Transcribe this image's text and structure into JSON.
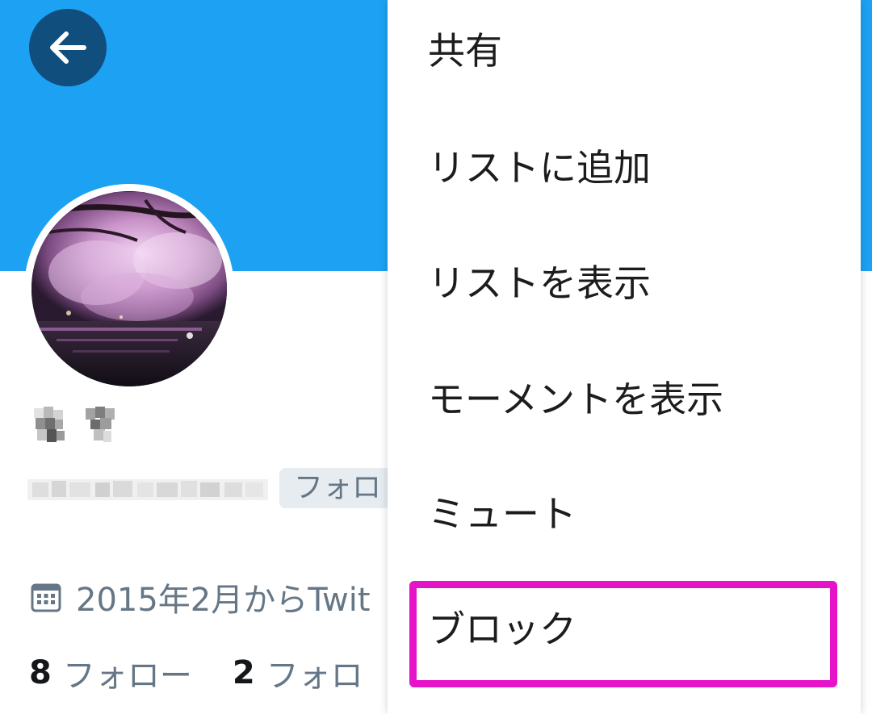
{
  "colors": {
    "banner": "#1da1f2",
    "back_button": "#0f4e7d",
    "muted_text": "#657786",
    "strong_text": "#14171a",
    "badge_bg": "#e6ecf0",
    "highlight": "#e614c8"
  },
  "header": {
    "back_icon": "arrow-left-icon"
  },
  "profile": {
    "avatar_description": "cherry-blossom-night-photo",
    "display_name": "",
    "handle": "",
    "follows_you_badge": "フォロ",
    "joined_icon": "calendar-icon",
    "joined_text": "2015年2月からTwit",
    "stats": {
      "following_count": "8",
      "following_label": "フォロー",
      "followers_count": "2",
      "followers_label": "フォロ"
    }
  },
  "menu": {
    "items": [
      {
        "label": "共有"
      },
      {
        "label": "リストに追加"
      },
      {
        "label": "リストを表示"
      },
      {
        "label": "モーメントを表示"
      },
      {
        "label": "ミュート"
      },
      {
        "label": "ブロック",
        "highlighted": true
      }
    ]
  }
}
